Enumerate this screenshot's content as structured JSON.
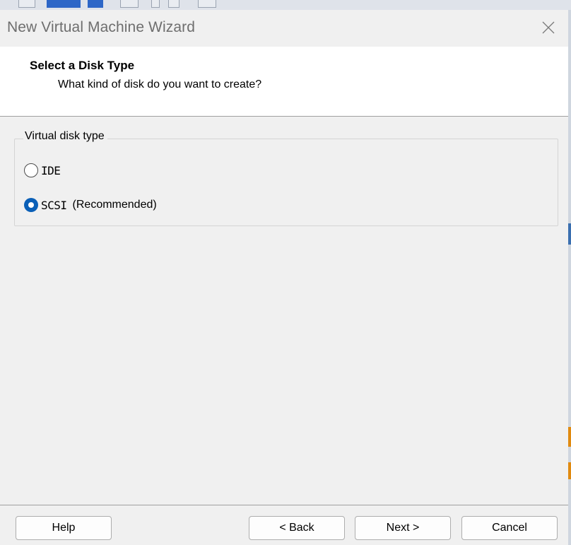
{
  "window": {
    "title": "New Virtual Machine Wizard"
  },
  "header": {
    "title": "Select a Disk Type",
    "subtitle": "What kind of disk do you want to create?"
  },
  "disk_type_group": {
    "legend": "Virtual disk type",
    "options": [
      {
        "label": "IDE",
        "extra": "",
        "selected": false
      },
      {
        "label": "SCSI",
        "extra": "(Recommended)",
        "selected": true
      }
    ]
  },
  "buttons": {
    "help": "Help",
    "back": "< Back",
    "next": "Next >",
    "cancel": "Cancel"
  },
  "colors": {
    "accent": "#0a5fb7",
    "background": "#f0f0f0",
    "header_bg": "#ffffff",
    "title_text": "#6e6e6e"
  },
  "icons": {
    "close": "close-icon"
  }
}
